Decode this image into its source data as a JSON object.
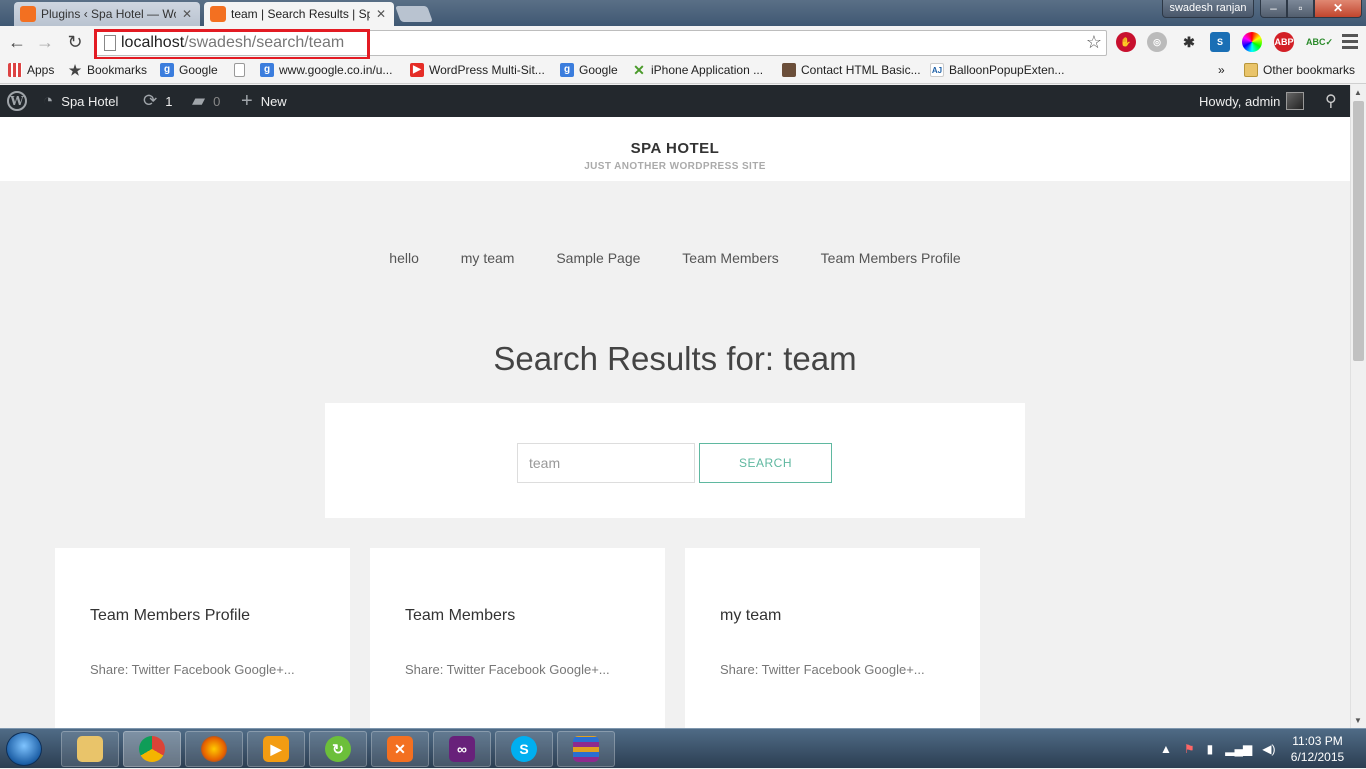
{
  "browser": {
    "tabs": [
      {
        "title": "Plugins ‹ Spa Hotel — Wo",
        "active": false
      },
      {
        "title": "team | Search Results | Sp",
        "active": true
      }
    ],
    "user_name": "swadesh ranjan",
    "url_host": "localhost",
    "url_path": "/swadesh/search/team"
  },
  "bookmarks": [
    {
      "label": "Apps",
      "icon": "apps-grid-icon"
    },
    {
      "label": "Bookmarks",
      "icon": "star-icon"
    },
    {
      "label": "Google",
      "icon": "google-icon"
    },
    {
      "label": "www.google.co.in/u...",
      "icon": "google-icon"
    },
    {
      "label": "WordPress Multi-Sit...",
      "icon": "youtube-icon"
    },
    {
      "label": "Google",
      "icon": "google-icon"
    },
    {
      "label": "iPhone Application ...",
      "icon": "x-icon"
    },
    {
      "label": "Contact HTML Basic...",
      "icon": "page-icon"
    },
    {
      "label": "BalloonPopupExten...",
      "icon": "aspnet-icon"
    },
    {
      "label": "»",
      "icon": ""
    },
    {
      "label": "Other bookmarks",
      "icon": "folder-icon"
    }
  ],
  "adminbar": {
    "site_name": "Spa Hotel",
    "updates_count": "1",
    "comments_count": "0",
    "new_label": "New",
    "greeting": "Howdy, admin"
  },
  "site": {
    "title": "SPA HOTEL",
    "tagline": "JUST ANOTHER WORDPRESS SITE"
  },
  "nav": [
    "hello",
    "my team",
    "Sample Page",
    "Team Members",
    "Team Members Profile"
  ],
  "search": {
    "heading": "Search Results for: team",
    "input_value": "team",
    "button_label": "SEARCH"
  },
  "results": [
    {
      "title": "Team Members Profile",
      "share": "Share: Twitter Facebook Google+..."
    },
    {
      "title": "Team Members",
      "share": "Share: Twitter Facebook Google+..."
    },
    {
      "title": "my team",
      "share": "Share: Twitter Facebook Google+..."
    }
  ],
  "taskbar": {
    "time": "11:03 PM",
    "date": "6/12/2015"
  },
  "colors": {
    "accent": "#5fb8a0",
    "adminbar": "#23282d",
    "url_highlight": "#e31b23"
  }
}
